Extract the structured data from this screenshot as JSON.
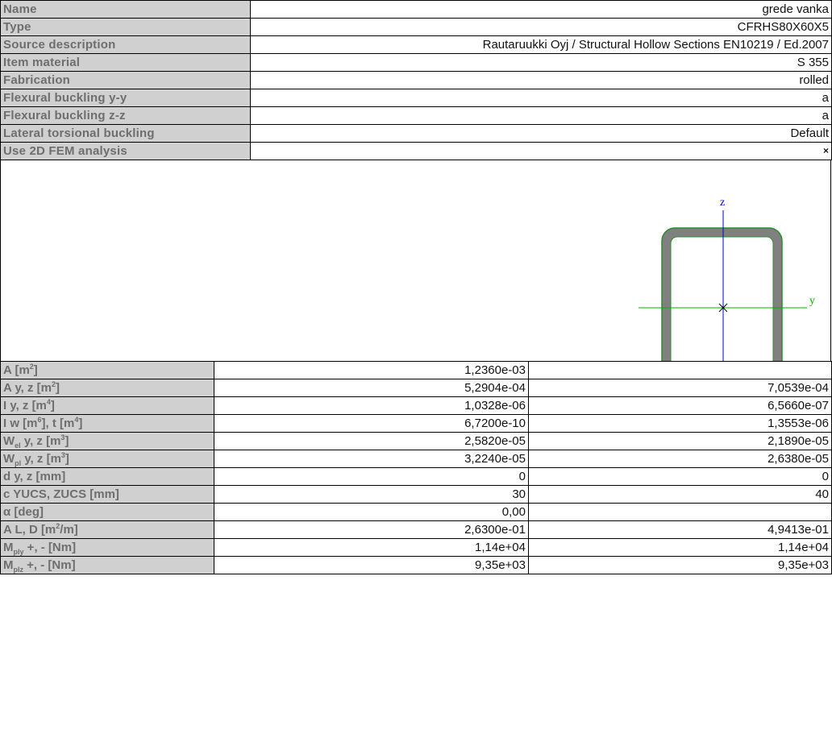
{
  "properties": [
    {
      "label": "Name",
      "value": "grede vanka"
    },
    {
      "label": "Type",
      "value": "CFRHS80X60X5"
    },
    {
      "label": "Source description",
      "value": "Rautaruukki Oyj / Structural Hollow Sections EN10219 / Ed.2007"
    },
    {
      "label": "Item material",
      "value": "S 355"
    },
    {
      "label": "Fabrication",
      "value": "rolled"
    },
    {
      "label": "Flexural buckling y-y",
      "value": "a"
    },
    {
      "label": "Flexural buckling z-z",
      "value": "a"
    },
    {
      "label": "Lateral torsional buckling",
      "value": "Default"
    },
    {
      "label": "Use 2D FEM analysis",
      "value": "×"
    }
  ],
  "section_drawing": {
    "axis_z_label": "z",
    "axis_y_label": "y",
    "section_fill": "#808080",
    "section_outline": "#2e8b2e",
    "axis_z_color": "#0000cc",
    "axis_y_color": "#00b000"
  },
  "results": [
    {
      "label": [
        "A [m",
        "2",
        "]"
      ],
      "v1": "1,2360e-03",
      "v2": ""
    },
    {
      "label": [
        "A y, z [m",
        "2",
        "]"
      ],
      "v1": "5,2904e-04",
      "v2": "7,0539e-04"
    },
    {
      "label": [
        "I y, z [m",
        "4",
        "]"
      ],
      "v1": "1,0328e-06",
      "v2": "6,5660e-07"
    },
    {
      "label": [
        "I w [m",
        "6",
        "], t [m",
        "4",
        "]"
      ],
      "v1": "6,7200e-10",
      "v2": "1,3553e-06"
    },
    {
      "label": [
        "W",
        "el",
        " y, z [m",
        "3",
        "]"
      ],
      "v1": "2,5820e-05",
      "v2": "2,1890e-05"
    },
    {
      "label": [
        "W",
        "pl",
        " y, z [m",
        "3",
        "]"
      ],
      "v1": "3,2240e-05",
      "v2": "2,6380e-05"
    },
    {
      "label": [
        "d y, z [mm]"
      ],
      "v1": "0",
      "v2": "0"
    },
    {
      "label": [
        "c YUCS, ZUCS [mm]"
      ],
      "v1": "30",
      "v2": "40"
    },
    {
      "label": [
        "α [deg]"
      ],
      "v1": "0,00",
      "v2": ""
    },
    {
      "label": [
        "A L, D [m",
        "2",
        "/m]"
      ],
      "v1": "2,6300e-01",
      "v2": "4,9413e-01"
    },
    {
      "label": [
        "M",
        "ply",
        " +, - [Nm]"
      ],
      "v1": "1,14e+04",
      "v2": "1,14e+04"
    },
    {
      "label": [
        "M",
        "plz",
        " +, - [Nm]"
      ],
      "v1": "9,35e+03",
      "v2": "9,35e+03"
    }
  ]
}
